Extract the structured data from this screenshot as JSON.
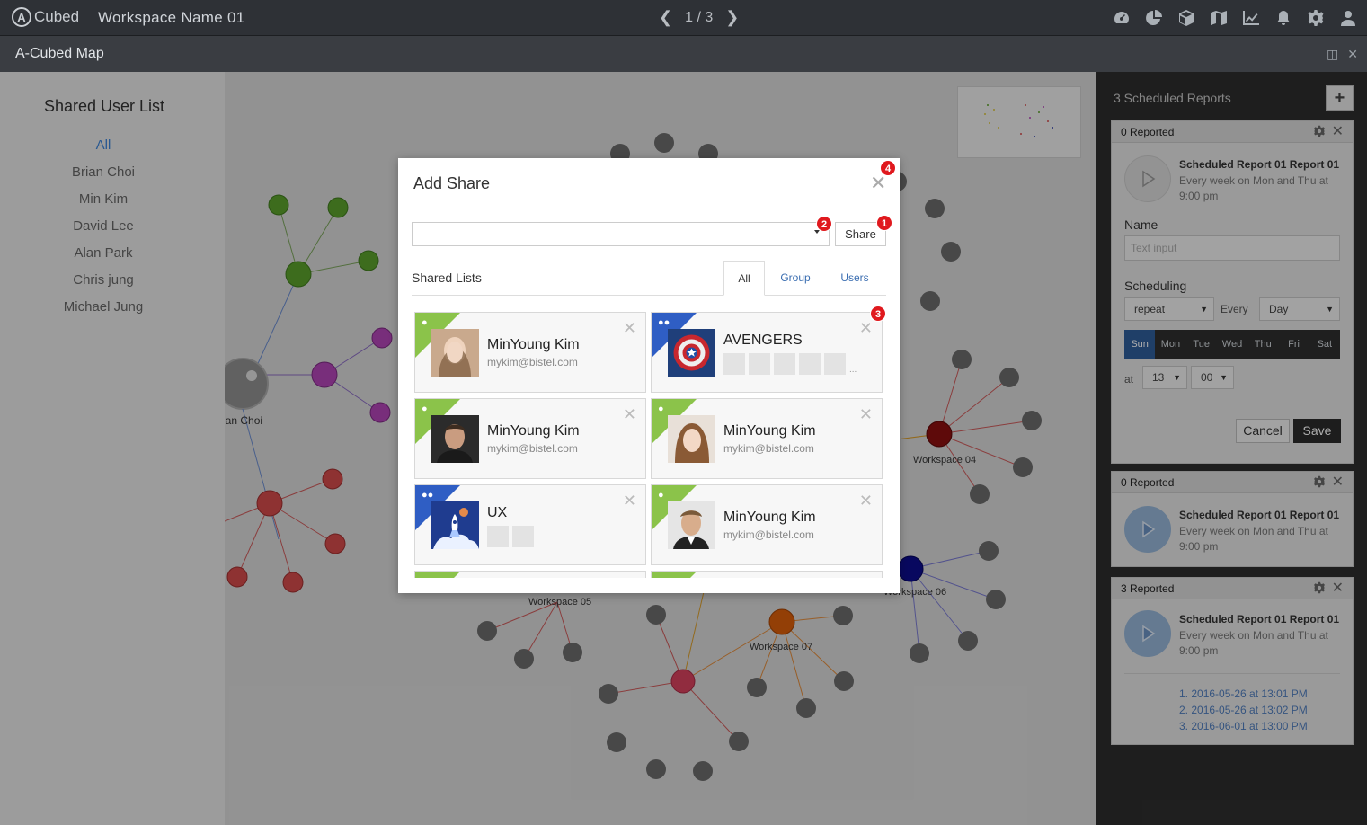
{
  "app": {
    "logo_text": "Cubed",
    "workspace_name": "Workspace Name 01",
    "page_indicator": "1 / 3",
    "panel_title": "A-Cubed Map"
  },
  "top_icons": [
    "dashboard-icon",
    "pie-chart-icon",
    "cube-icon",
    "map-icon",
    "line-chart-icon",
    "bell-icon",
    "gear-icon",
    "user-icon"
  ],
  "sidebar": {
    "title": "Shared User List",
    "users": [
      "All",
      "Brian Choi",
      "Min Kim",
      "David Lee",
      "Alan Park",
      "Chris jung",
      "Michael Jung"
    ]
  },
  "map": {
    "node_labels": [
      "ian Choi",
      "Workspace 04",
      "Workspace 05",
      "Workspace 06",
      "Workspace 07"
    ]
  },
  "reports": {
    "header": "3 Scheduled Reports",
    "add_label": "+",
    "cards": [
      {
        "status": "0 Reported",
        "title": "Scheduled Report 01 Report 01",
        "desc": "Every week on Mon and Thu at 9:00 pm",
        "name_label": "Name",
        "name_placeholder": "Text input",
        "scheduling_label": "Scheduling",
        "repeat_value": "repeat",
        "every_label": "Every",
        "unit_value": "Day",
        "days": [
          "Sun",
          "Mon",
          "Tue",
          "Wed",
          "Thu",
          "Fri",
          "Sat"
        ],
        "at_label": "at",
        "hour_value": "13",
        "minute_value": "00",
        "cancel_label": "Cancel",
        "save_label": "Save"
      },
      {
        "status": "0 Reported",
        "title": "Scheduled Report 01 Report 01",
        "desc": "Every week on Mon and Thu at 9:00 pm"
      },
      {
        "status": "3 Reported",
        "title": "Scheduled Report 01 Report 01",
        "desc": "Every week on Mon and Thu at 9:00 pm",
        "log": [
          "1. 2016-05-26 at 13:01 PM",
          "2. 2016-05-26 at 13:02 PM",
          "3. 2016-06-01 at 13:00 PM"
        ]
      }
    ]
  },
  "modal": {
    "title": "Add Share",
    "share_button": "Share",
    "shared_lists_label": "Shared Lists",
    "tabs": [
      "All",
      "Group",
      "Users"
    ],
    "badges": [
      "1",
      "2",
      "3",
      "4"
    ],
    "items": [
      {
        "type": "user",
        "name": "MinYoung Kim",
        "email": "mykim@bistel.com"
      },
      {
        "type": "group",
        "name": "AVENGERS",
        "more": "..."
      },
      {
        "type": "user",
        "name": "MinYoung Kim",
        "email": "mykim@bistel.com"
      },
      {
        "type": "user",
        "name": "MinYoung Kim",
        "email": "mykim@bistel.com"
      },
      {
        "type": "group",
        "name": "UX"
      },
      {
        "type": "user",
        "name": "MinYoung Kim",
        "email": "mykim@bistel.com"
      }
    ]
  },
  "colors": {
    "accent_blue": "#3b82d6",
    "user_tag": "#8bc34a",
    "group_tag": "#2f5ec4",
    "badge_red": "#e0191e"
  }
}
